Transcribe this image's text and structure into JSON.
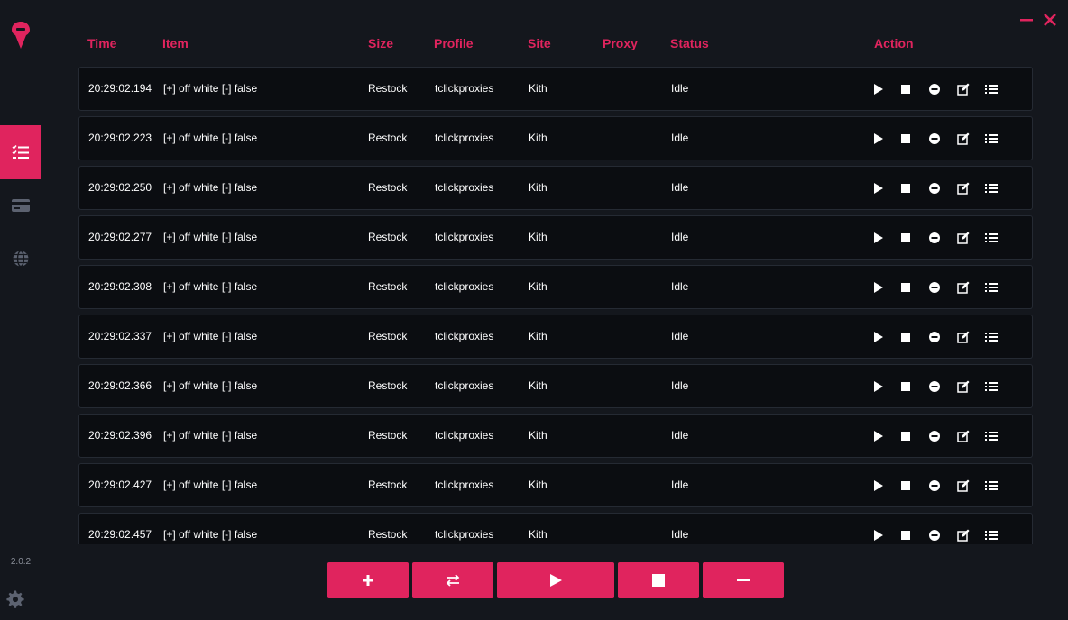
{
  "app": {
    "accent": "#e0245e",
    "version": "2.0.2"
  },
  "sidebar": {
    "items": [
      {
        "icon": "tasks-list-icon",
        "active": true
      },
      {
        "icon": "credit-card-icon",
        "active": false
      },
      {
        "icon": "globe-icon",
        "active": false
      }
    ],
    "settings_icon": "gear-icon"
  },
  "table": {
    "headers": {
      "time": "Time",
      "item": "Item",
      "size": "Size",
      "profile": "Profile",
      "site": "Site",
      "proxy": "Proxy",
      "status": "Status",
      "action": "Action"
    },
    "rows": [
      {
        "time": "20:29:02.194",
        "item": "[+] off white [-] false",
        "size": "Restock",
        "profile": "tclickproxies",
        "site": "Kith",
        "proxy": "",
        "status": "Idle"
      },
      {
        "time": "20:29:02.223",
        "item": "[+] off white [-] false",
        "size": "Restock",
        "profile": "tclickproxies",
        "site": "Kith",
        "proxy": "",
        "status": "Idle"
      },
      {
        "time": "20:29:02.250",
        "item": "[+] off white [-] false",
        "size": "Restock",
        "profile": "tclickproxies",
        "site": "Kith",
        "proxy": "",
        "status": "Idle"
      },
      {
        "time": "20:29:02.277",
        "item": "[+] off white [-] false",
        "size": "Restock",
        "profile": "tclickproxies",
        "site": "Kith",
        "proxy": "",
        "status": "Idle"
      },
      {
        "time": "20:29:02.308",
        "item": "[+] off white [-] false",
        "size": "Restock",
        "profile": "tclickproxies",
        "site": "Kith",
        "proxy": "",
        "status": "Idle"
      },
      {
        "time": "20:29:02.337",
        "item": "[+] off white [-] false",
        "size": "Restock",
        "profile": "tclickproxies",
        "site": "Kith",
        "proxy": "",
        "status": "Idle"
      },
      {
        "time": "20:29:02.366",
        "item": "[+] off white [-] false",
        "size": "Restock",
        "profile": "tclickproxies",
        "site": "Kith",
        "proxy": "",
        "status": "Idle"
      },
      {
        "time": "20:29:02.396",
        "item": "[+] off white [-] false",
        "size": "Restock",
        "profile": "tclickproxies",
        "site": "Kith",
        "proxy": "",
        "status": "Idle"
      },
      {
        "time": "20:29:02.427",
        "item": "[+] off white [-] false",
        "size": "Restock",
        "profile": "tclickproxies",
        "site": "Kith",
        "proxy": "",
        "status": "Idle"
      },
      {
        "time": "20:29:02.457",
        "item": "[+] off white [-] false",
        "size": "Restock",
        "profile": "tclickproxies",
        "site": "Kith",
        "proxy": "",
        "status": "Idle"
      }
    ],
    "row_actions": [
      "play-icon",
      "stop-icon",
      "remove-icon",
      "edit-icon",
      "details-list-icon"
    ]
  },
  "bottom_actions": [
    {
      "name": "add-task-button",
      "icon": "plus-icon"
    },
    {
      "name": "swap-button",
      "icon": "swap-arrows-icon"
    },
    {
      "name": "start-all-button",
      "icon": "play-icon"
    },
    {
      "name": "stop-all-button",
      "icon": "stop-icon"
    },
    {
      "name": "delete-all-button",
      "icon": "minus-icon"
    }
  ]
}
